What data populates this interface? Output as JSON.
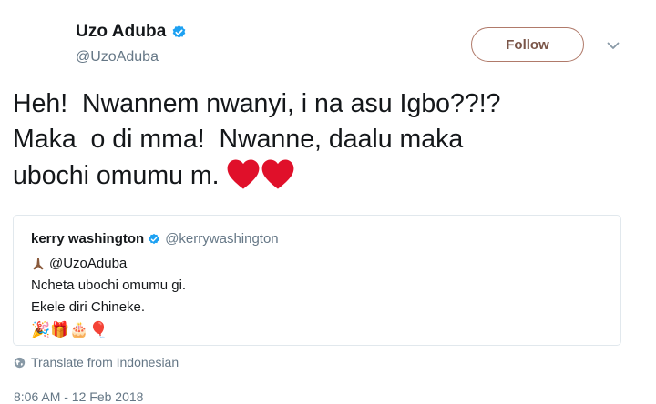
{
  "author": {
    "name": "Uzo Aduba",
    "handle": "@UzoAduba"
  },
  "follow_label": "Follow",
  "tweet": {
    "lines": [
      "Heh!  Nwannem nwanyi, i na asu Igbo??!?",
      "Maka  o di mma!  Nwanne, daalu maka",
      "ubochi omumu m. "
    ],
    "emoji": [
      "red-heart",
      "red-heart"
    ]
  },
  "quoted_tweet": {
    "name": "kerry washington",
    "handle": "@kerrywashington",
    "line1": "@UzoAduba",
    "line2": "Ncheta ubochi omumu gi.",
    "line3": "Ekele diri Chineke.",
    "line4": "🎉🎁🎂🎈"
  },
  "translate_label": "Translate from Indonesian",
  "timestamp": "8:06 AM - 12 Feb 2018",
  "colors": {
    "verified": "#1da1f2",
    "heart": "#e0102a",
    "follow_border": "#b07a6a"
  }
}
